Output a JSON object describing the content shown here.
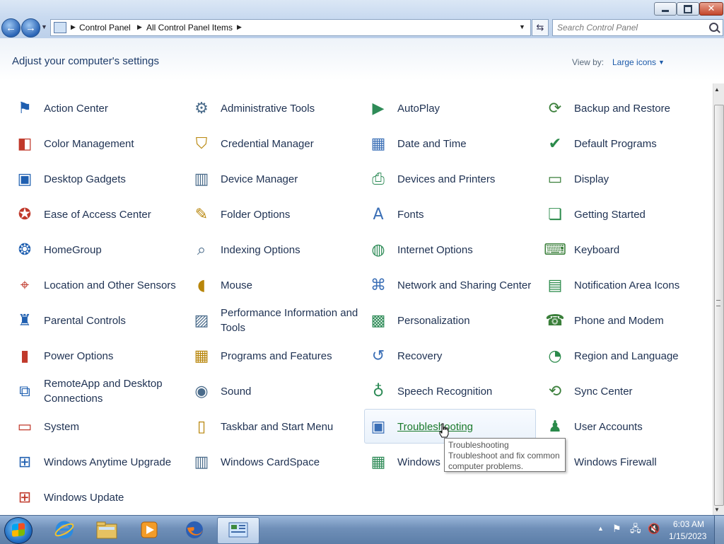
{
  "window": {
    "buttons": {
      "minimize": "minimize",
      "maximize": "maximize",
      "close": "✕"
    }
  },
  "address_bar": {
    "breadcrumbs": [
      "Control Panel",
      "All Control Panel Items"
    ],
    "search_placeholder": "Search Control Panel"
  },
  "header": {
    "title": "Adjust your computer's settings",
    "view_by_label": "View by:",
    "view_by_value": "Large icons"
  },
  "items": [
    {
      "label": "Action Center",
      "icon": "flag-icon"
    },
    {
      "label": "Administrative Tools",
      "icon": "admin-tools-icon"
    },
    {
      "label": "AutoPlay",
      "icon": "autoplay-icon"
    },
    {
      "label": "Backup and Restore",
      "icon": "backup-icon"
    },
    {
      "label": "Color Management",
      "icon": "color-management-icon"
    },
    {
      "label": "Credential Manager",
      "icon": "credential-icon"
    },
    {
      "label": "Date and Time",
      "icon": "calendar-clock-icon"
    },
    {
      "label": "Default Programs",
      "icon": "default-programs-icon"
    },
    {
      "label": "Desktop Gadgets",
      "icon": "gadgets-icon"
    },
    {
      "label": "Device Manager",
      "icon": "device-manager-icon"
    },
    {
      "label": "Devices and Printers",
      "icon": "printer-icon"
    },
    {
      "label": "Display",
      "icon": "monitor-icon"
    },
    {
      "label": "Ease of Access Center",
      "icon": "ease-of-access-icon"
    },
    {
      "label": "Folder Options",
      "icon": "folder-options-icon"
    },
    {
      "label": "Fonts",
      "icon": "fonts-icon"
    },
    {
      "label": "Getting Started",
      "icon": "getting-started-icon"
    },
    {
      "label": "HomeGroup",
      "icon": "homegroup-icon"
    },
    {
      "label": "Indexing Options",
      "icon": "indexing-icon"
    },
    {
      "label": "Internet Options",
      "icon": "internet-options-icon"
    },
    {
      "label": "Keyboard",
      "icon": "keyboard-icon"
    },
    {
      "label": "Location and Other Sensors",
      "icon": "location-sensor-icon"
    },
    {
      "label": "Mouse",
      "icon": "mouse-icon"
    },
    {
      "label": "Network and Sharing Center",
      "icon": "network-icon"
    },
    {
      "label": "Notification Area Icons",
      "icon": "notification-area-icon"
    },
    {
      "label": "Parental Controls",
      "icon": "parental-controls-icon"
    },
    {
      "label": "Performance Information and Tools",
      "icon": "performance-icon"
    },
    {
      "label": "Personalization",
      "icon": "personalization-icon"
    },
    {
      "label": "Phone and Modem",
      "icon": "phone-icon"
    },
    {
      "label": "Power Options",
      "icon": "battery-icon"
    },
    {
      "label": "Programs and Features",
      "icon": "programs-icon"
    },
    {
      "label": "Recovery",
      "icon": "recovery-icon"
    },
    {
      "label": "Region and Language",
      "icon": "globe-clock-icon"
    },
    {
      "label": "RemoteApp and Desktop Connections",
      "icon": "remoteapp-icon"
    },
    {
      "label": "Sound",
      "icon": "speaker-icon"
    },
    {
      "label": "Speech Recognition",
      "icon": "microphone-icon"
    },
    {
      "label": "Sync Center",
      "icon": "sync-icon"
    },
    {
      "label": "System",
      "icon": "system-icon"
    },
    {
      "label": "Taskbar and Start Menu",
      "icon": "taskbar-icon"
    },
    {
      "label": "Troubleshooting",
      "icon": "troubleshooting-icon"
    },
    {
      "label": "User Accounts",
      "icon": "users-icon"
    },
    {
      "label": "Windows Anytime Upgrade",
      "icon": "windows-logo-icon"
    },
    {
      "label": "Windows CardSpace",
      "icon": "cardspace-icon"
    },
    {
      "label": "Windows",
      "icon": "firewall-brick-icon"
    },
    {
      "label": "Windows Firewall",
      "icon": "firewall-globe-icon"
    },
    {
      "label": "Windows Update",
      "icon": "windows-update-icon"
    }
  ],
  "tooltip": {
    "title": "Troubleshooting",
    "description": "Troubleshoot and fix common computer problems."
  },
  "taskbar": {
    "apps": [
      "internet-explorer-icon",
      "windows-explorer-icon",
      "media-player-icon",
      "firefox-icon",
      "control-panel-icon"
    ],
    "clock_time": "6:03 AM",
    "clock_date": "1/15/2023"
  }
}
